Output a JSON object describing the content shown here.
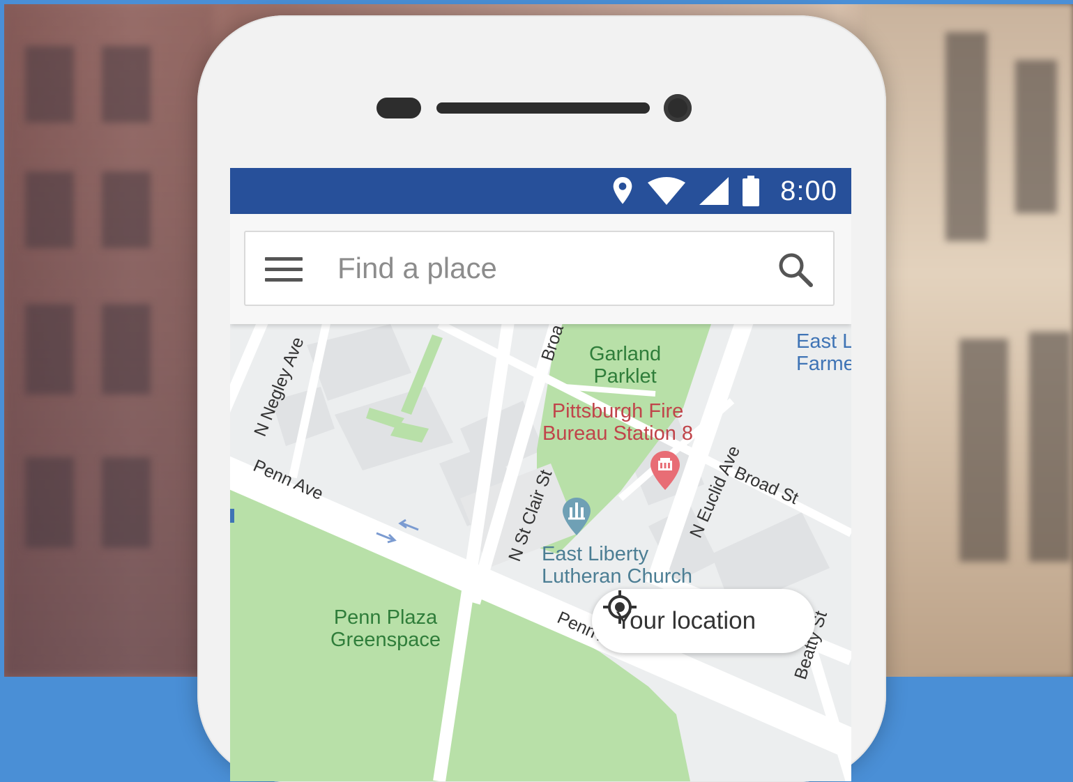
{
  "status_bar": {
    "time": "8:00",
    "icons": [
      "location-pin-icon",
      "wifi-icon",
      "cell-signal-icon",
      "battery-icon"
    ],
    "background": "#27509a"
  },
  "search": {
    "placeholder": "Find a place",
    "menu_icon": "menu-icon",
    "search_icon": "search-icon"
  },
  "map": {
    "places": {
      "garland": "Garland\nParklet",
      "fire_station": "Pittsburgh Fire\nBureau Station 8",
      "east_liberty_farmers": "East L\nFarme",
      "church": "East Liberty\nLutheran Church",
      "penn_plaza": "Penn Plaza\nGreenspace"
    },
    "streets": {
      "n_negley": "N Negley Ave",
      "penn_ave_1": "Penn Ave",
      "penn_ave_2": "Penn Ave",
      "broad_top": "Broa",
      "n_st_clair": "N St Clair St",
      "n_euclid": "N Euclid Ave",
      "broad_st": "Broad St",
      "beatty": "Beatty St"
    }
  },
  "location_button": {
    "label": "Your location"
  }
}
